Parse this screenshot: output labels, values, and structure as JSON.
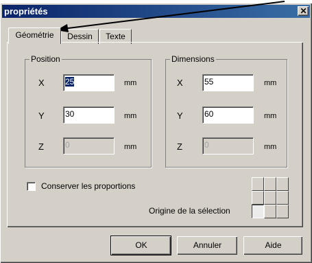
{
  "window": {
    "title": "propriétés",
    "close_glyph": "✕"
  },
  "tabs": [
    {
      "label": "Géométrie",
      "active": true
    },
    {
      "label": "Dessin",
      "active": false
    },
    {
      "label": "Texte",
      "active": false
    }
  ],
  "position": {
    "legend": "Position",
    "x": {
      "axis": "X",
      "value": "25",
      "unit": "mm"
    },
    "y": {
      "axis": "Y",
      "value": "30",
      "unit": "mm"
    },
    "z": {
      "axis": "Z",
      "value": "0",
      "unit": "mm",
      "disabled": true
    }
  },
  "dimensions": {
    "legend": "Dimensions",
    "x": {
      "axis": "X",
      "value": "55",
      "unit": "mm"
    },
    "y": {
      "axis": "Y",
      "value": "60",
      "unit": "mm"
    },
    "z": {
      "axis": "Z",
      "value": "0",
      "unit": "mm",
      "disabled": true
    }
  },
  "keep_proportions": {
    "label": "Conserver les proportions",
    "checked": false
  },
  "origin": {
    "label": "Origine de la sélection",
    "selected_cell": "bottom-left"
  },
  "buttons": {
    "ok": "OK",
    "cancel": "Annuler",
    "help": "Aide"
  },
  "colors": {
    "titlebar_start": "#0a246a",
    "titlebar_end": "#3a6ea5",
    "dialog_face": "#d4d0c8"
  }
}
